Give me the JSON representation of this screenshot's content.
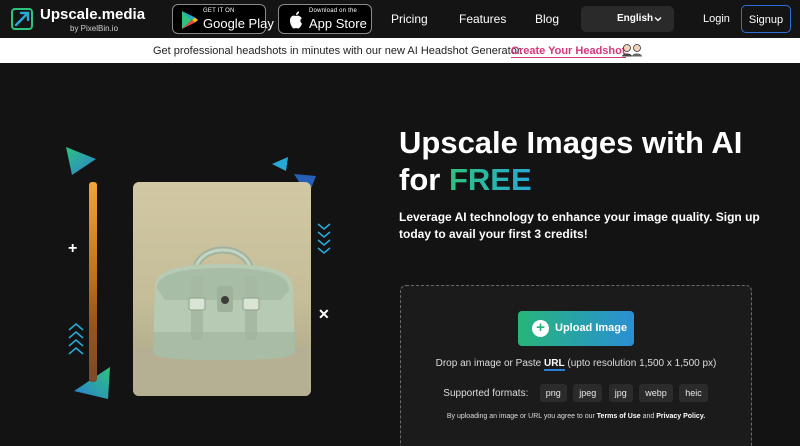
{
  "nav": {
    "logo_title": "Upscale.media",
    "logo_sub": "by PixelBin.io",
    "google_play": {
      "small": "GET IT ON",
      "big": "Google Play"
    },
    "app_store": {
      "small": "Download on the",
      "big": "App Store"
    },
    "links": [
      "Pricing",
      "Features",
      "Blog"
    ],
    "language": "English",
    "login": "Login",
    "signup": "Signup"
  },
  "promo": {
    "text": "Get professional headshots in minutes with our new AI Headshot Generator.",
    "link": "Create Your Headshot"
  },
  "hero": {
    "title_line1": "Upscale Images with AI",
    "title_line2_pre": "for",
    "title_line2_highlight": "FREE",
    "description": "Leverage AI technology to enhance your image quality. Sign up today to avail your first 3 credits!"
  },
  "upload": {
    "button_label": "Upload Image",
    "drop_pre": "Drop an image or Paste",
    "drop_url": "URL",
    "drop_post": "(upto resolution 1,500 x 1,500 px)",
    "formats_label": "Supported formats:",
    "formats": [
      "png",
      "jpeg",
      "jpg",
      "webp",
      "heic"
    ],
    "terms_pre": "By uploading an image or URL you agree to our",
    "terms_link1": "Terms of Use",
    "terms_and": "and",
    "terms_link2": "Privacy Policy."
  },
  "colors": {
    "background": "#131313",
    "accent_green": "#27b57a",
    "accent_blue": "#2a8fd4",
    "promo_link": "#d5377c"
  }
}
